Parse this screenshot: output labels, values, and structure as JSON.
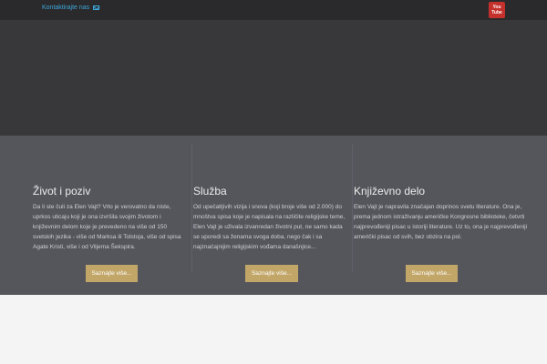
{
  "topbar": {
    "contact_label": "Kontaktirajte nas",
    "youtube": {
      "line1": "You",
      "line2": "Tube"
    },
    "icons": {
      "contact": "mail-icon",
      "social": "youtube-icon"
    }
  },
  "features": [
    {
      "title": "Život i poziv",
      "text": "Da li ste čuli za Elen Vajt? Vrlo je verovatno da niste, uprkos uticaju koji je ona izvršila svojim životom i književnim delom koje je prevedeno na više od 150 svetskih jezika - više od Marksa ili Tolstoja, više od spisa Agate Kristi, više i od Viljema Šekspira.",
      "button": "Saznajte više..."
    },
    {
      "title": "Služba",
      "text": "Od upečatljivih vizija i snova (koji broje više od 2.000) do mnoštva spisa koje je napisala na različite religijske teme, Elen Vajt je uživala izvanredan životni put, ne samo kada se uporedi sa ženama svoga doba, nego čak i sa najznačajnijim religijskim vođama današnjice...",
      "button": "Saznajte više..."
    },
    {
      "title": "Književno delo",
      "text": "Elen Vajt je napravila značajan doprinos svetu literature. Ona je, prema jednom istraživanju američke Kongresne biblioteke, četvrti najprevođeniji pisac u istoriji literature. Uz to, ona je najprevođeniji američki pisac od svih, bez obzira na pol.",
      "button": "Saznajte više..."
    }
  ]
}
